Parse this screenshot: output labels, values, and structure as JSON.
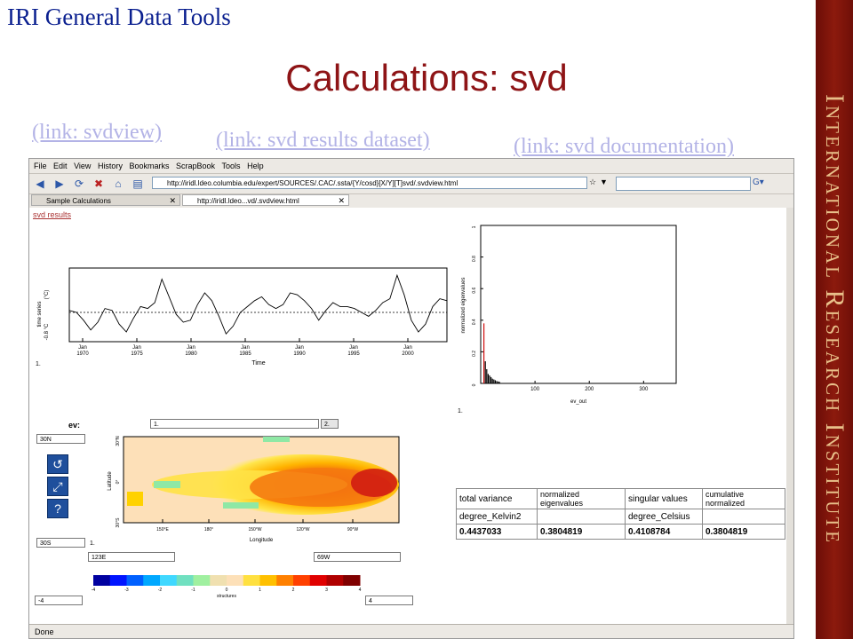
{
  "header": {
    "brand": "IRI General Data Tools",
    "title": "Calculations: svd"
  },
  "links": [
    "(link: svdview)",
    "(link: svd results dataset)",
    "(link: svd documentation)"
  ],
  "side_banner": "International Research Institute",
  "browser": {
    "menu": [
      "File",
      "Edit",
      "View",
      "History",
      "Bookmarks",
      "ScrapBook",
      "Tools",
      "Help"
    ],
    "url": "http://iridl.ldeo.columbia.edu/expert/SOURCES/.CAC/.ssta/{Y/cosd}[X/Y][T]svd/.svdview.html",
    "tabs": [
      {
        "label": "Sample Calculations"
      },
      {
        "label": "http://iridl.ldeo...vd/.svdview.html"
      }
    ],
    "status": "Done"
  },
  "page": {
    "results_link": "svd results",
    "ts": {
      "ylabel": "time series",
      "ylabel2": "(°C)",
      "ylabel3": "-0.8 °C",
      "xlabel": "Time",
      "ticks": [
        {
          "year": "1970",
          "mon": "Jan"
        },
        {
          "year": "1975",
          "mon": "Jan"
        },
        {
          "year": "1980",
          "mon": "Jan"
        },
        {
          "year": "1985",
          "mon": "Jan"
        },
        {
          "year": "1990",
          "mon": "Jan"
        },
        {
          "year": "1995",
          "mon": "Jan"
        },
        {
          "year": "2000",
          "mon": "Jan"
        }
      ],
      "caption": "1."
    },
    "eig": {
      "ylabel": "normalized eigenvalues",
      "xlabel": "ev_out",
      "yticks": [
        "0",
        "0.2",
        "0.4",
        "0.6",
        "0.8",
        "1"
      ],
      "xticks": [
        "100",
        "200",
        "300"
      ],
      "caption": "1."
    },
    "map": {
      "ev_label": "ev:",
      "ev_value": "1.",
      "ev_next": "2.",
      "lat_top": "30N",
      "lat_bot": "30S",
      "lon_left": "123E",
      "lon_right": "69W",
      "ylabel": "Latitude",
      "xlabel": "Longitude",
      "yticks": [
        "30°N",
        "0°",
        "30°S"
      ],
      "xticks": [
        "150°E",
        "180°",
        "150°W",
        "120°W",
        "90°W"
      ],
      "caption": "1.",
      "cb_min": "-4",
      "cb_max": "4",
      "cb_label": "structures",
      "cb_ticks": [
        "-4",
        "-3",
        "-2",
        "-1",
        "0",
        "1",
        "2",
        "3",
        "4"
      ]
    },
    "stats": {
      "headers": [
        "total variance",
        "normalized eigenvalues",
        "singular values",
        "cumulative normalized"
      ],
      "units": [
        "degree_Kelvin2",
        "",
        "degree_Celsius",
        ""
      ],
      "values": [
        "0.4437033",
        "0.3804819",
        "0.4108784",
        "0.3804819"
      ]
    }
  },
  "chart_data": [
    {
      "type": "line",
      "title": "",
      "xlabel": "Time",
      "ylabel": "time series",
      "x_range": [
        "Jan 1970",
        "2003"
      ],
      "series": [
        {
          "values": [
            0.1,
            0.0,
            -0.4,
            -0.9,
            -0.5,
            0.2,
            0.1,
            -0.6,
            -1.0,
            -0.3,
            0.3,
            0.2,
            0.5,
            1.7,
            0.8,
            -0.1,
            -0.5,
            -0.4,
            0.4,
            1.0,
            0.6,
            -0.2,
            -1.1,
            -0.7,
            0.0,
            0.3,
            0.6,
            0.8,
            0.4,
            0.2,
            0.4,
            1.0,
            0.9,
            0.6,
            0.2,
            -0.4,
            0.1,
            0.5,
            0.3,
            0.3,
            0.2,
            0.0,
            -0.2,
            0.1,
            0.5,
            0.7,
            1.9,
            0.9,
            -0.4,
            -1.0,
            -0.6,
            0.3,
            0.7,
            0.6
          ]
        }
      ]
    },
    {
      "type": "bar",
      "title": "",
      "xlabel": "ev_out",
      "ylabel": "normalized eigenvalues",
      "ylim": [
        0,
        1
      ],
      "xlim": [
        0,
        360
      ],
      "values": [
        0.38,
        0.14,
        0.09,
        0.06,
        0.05,
        0.04,
        0.03,
        0.025,
        0.02,
        0.015,
        0.012,
        0.01
      ]
    }
  ]
}
